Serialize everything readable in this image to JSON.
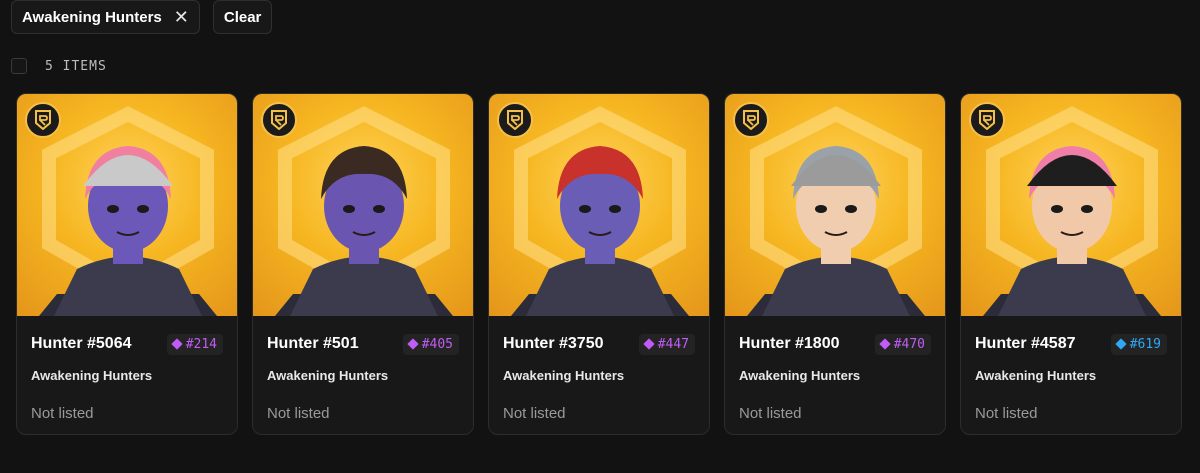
{
  "filters": {
    "active_filter": "Awakening Hunters",
    "close_symbol": "✕",
    "clear_label": "Clear"
  },
  "summary": {
    "count_label": "5 ITEMS"
  },
  "cards": [
    {
      "name": "Hunter #5064",
      "rank": "#214",
      "rank_color": "#c05cf5",
      "collection": "Awakening Hunters",
      "status": "Not listed",
      "skin": "#6b58b8",
      "hair": "#f07fa0",
      "hat": "#c9c9c9"
    },
    {
      "name": "Hunter #501",
      "rank": "#405",
      "rank_color": "#c05cf5",
      "collection": "Awakening Hunters",
      "status": "Not listed",
      "skin": "#6a55b0",
      "hair": "#3a2a22",
      "hat": ""
    },
    {
      "name": "Hunter #3750",
      "rank": "#447",
      "rank_color": "#c05cf5",
      "collection": "Awakening Hunters",
      "status": "Not listed",
      "skin": "#6a5db5",
      "hair": "#c8322a",
      "hat": ""
    },
    {
      "name": "Hunter #1800",
      "rank": "#470",
      "rank_color": "#c05cf5",
      "collection": "Awakening Hunters",
      "status": "Not listed",
      "skin": "#f1cdb0",
      "hair": "#9aa1a8",
      "hat": "#9b9b9b"
    },
    {
      "name": "Hunter #4587",
      "rank": "#619",
      "rank_color": "#2fa8f5",
      "collection": "Awakening Hunters",
      "status": "Not listed",
      "skin": "#f1c9a8",
      "hair": "#ef7fa8",
      "hat": "#1e1e1e"
    }
  ]
}
